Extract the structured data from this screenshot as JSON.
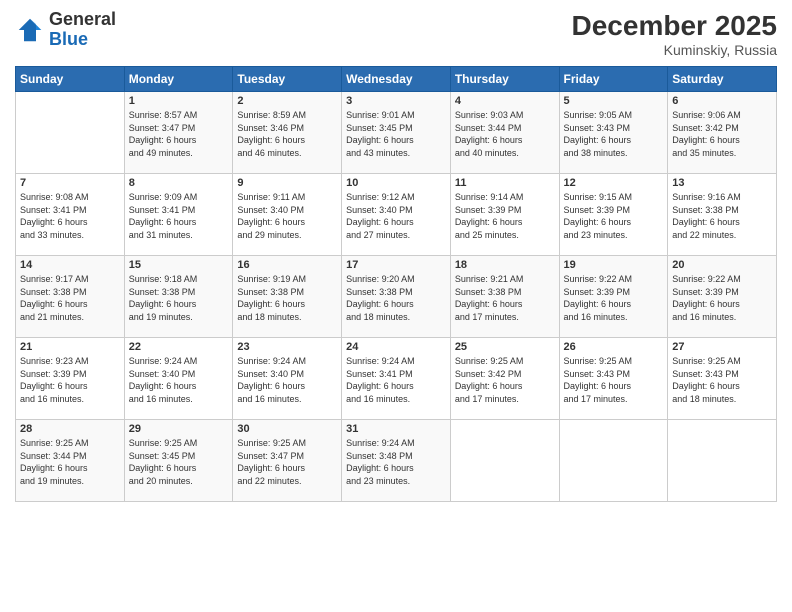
{
  "header": {
    "logo_general": "General",
    "logo_blue": "Blue",
    "title": "December 2025",
    "location": "Kuminskiy, Russia"
  },
  "days_of_week": [
    "Sunday",
    "Monday",
    "Tuesday",
    "Wednesday",
    "Thursday",
    "Friday",
    "Saturday"
  ],
  "weeks": [
    [
      {
        "day": "",
        "info": ""
      },
      {
        "day": "1",
        "info": "Sunrise: 8:57 AM\nSunset: 3:47 PM\nDaylight: 6 hours\nand 49 minutes."
      },
      {
        "day": "2",
        "info": "Sunrise: 8:59 AM\nSunset: 3:46 PM\nDaylight: 6 hours\nand 46 minutes."
      },
      {
        "day": "3",
        "info": "Sunrise: 9:01 AM\nSunset: 3:45 PM\nDaylight: 6 hours\nand 43 minutes."
      },
      {
        "day": "4",
        "info": "Sunrise: 9:03 AM\nSunset: 3:44 PM\nDaylight: 6 hours\nand 40 minutes."
      },
      {
        "day": "5",
        "info": "Sunrise: 9:05 AM\nSunset: 3:43 PM\nDaylight: 6 hours\nand 38 minutes."
      },
      {
        "day": "6",
        "info": "Sunrise: 9:06 AM\nSunset: 3:42 PM\nDaylight: 6 hours\nand 35 minutes."
      }
    ],
    [
      {
        "day": "7",
        "info": "Sunrise: 9:08 AM\nSunset: 3:41 PM\nDaylight: 6 hours\nand 33 minutes."
      },
      {
        "day": "8",
        "info": "Sunrise: 9:09 AM\nSunset: 3:41 PM\nDaylight: 6 hours\nand 31 minutes."
      },
      {
        "day": "9",
        "info": "Sunrise: 9:11 AM\nSunset: 3:40 PM\nDaylight: 6 hours\nand 29 minutes."
      },
      {
        "day": "10",
        "info": "Sunrise: 9:12 AM\nSunset: 3:40 PM\nDaylight: 6 hours\nand 27 minutes."
      },
      {
        "day": "11",
        "info": "Sunrise: 9:14 AM\nSunset: 3:39 PM\nDaylight: 6 hours\nand 25 minutes."
      },
      {
        "day": "12",
        "info": "Sunrise: 9:15 AM\nSunset: 3:39 PM\nDaylight: 6 hours\nand 23 minutes."
      },
      {
        "day": "13",
        "info": "Sunrise: 9:16 AM\nSunset: 3:38 PM\nDaylight: 6 hours\nand 22 minutes."
      }
    ],
    [
      {
        "day": "14",
        "info": "Sunrise: 9:17 AM\nSunset: 3:38 PM\nDaylight: 6 hours\nand 21 minutes."
      },
      {
        "day": "15",
        "info": "Sunrise: 9:18 AM\nSunset: 3:38 PM\nDaylight: 6 hours\nand 19 minutes."
      },
      {
        "day": "16",
        "info": "Sunrise: 9:19 AM\nSunset: 3:38 PM\nDaylight: 6 hours\nand 18 minutes."
      },
      {
        "day": "17",
        "info": "Sunrise: 9:20 AM\nSunset: 3:38 PM\nDaylight: 6 hours\nand 18 minutes."
      },
      {
        "day": "18",
        "info": "Sunrise: 9:21 AM\nSunset: 3:38 PM\nDaylight: 6 hours\nand 17 minutes."
      },
      {
        "day": "19",
        "info": "Sunrise: 9:22 AM\nSunset: 3:39 PM\nDaylight: 6 hours\nand 16 minutes."
      },
      {
        "day": "20",
        "info": "Sunrise: 9:22 AM\nSunset: 3:39 PM\nDaylight: 6 hours\nand 16 minutes."
      }
    ],
    [
      {
        "day": "21",
        "info": "Sunrise: 9:23 AM\nSunset: 3:39 PM\nDaylight: 6 hours\nand 16 minutes."
      },
      {
        "day": "22",
        "info": "Sunrise: 9:24 AM\nSunset: 3:40 PM\nDaylight: 6 hours\nand 16 minutes."
      },
      {
        "day": "23",
        "info": "Sunrise: 9:24 AM\nSunset: 3:40 PM\nDaylight: 6 hours\nand 16 minutes."
      },
      {
        "day": "24",
        "info": "Sunrise: 9:24 AM\nSunset: 3:41 PM\nDaylight: 6 hours\nand 16 minutes."
      },
      {
        "day": "25",
        "info": "Sunrise: 9:25 AM\nSunset: 3:42 PM\nDaylight: 6 hours\nand 17 minutes."
      },
      {
        "day": "26",
        "info": "Sunrise: 9:25 AM\nSunset: 3:43 PM\nDaylight: 6 hours\nand 17 minutes."
      },
      {
        "day": "27",
        "info": "Sunrise: 9:25 AM\nSunset: 3:43 PM\nDaylight: 6 hours\nand 18 minutes."
      }
    ],
    [
      {
        "day": "28",
        "info": "Sunrise: 9:25 AM\nSunset: 3:44 PM\nDaylight: 6 hours\nand 19 minutes."
      },
      {
        "day": "29",
        "info": "Sunrise: 9:25 AM\nSunset: 3:45 PM\nDaylight: 6 hours\nand 20 minutes."
      },
      {
        "day": "30",
        "info": "Sunrise: 9:25 AM\nSunset: 3:47 PM\nDaylight: 6 hours\nand 22 minutes."
      },
      {
        "day": "31",
        "info": "Sunrise: 9:24 AM\nSunset: 3:48 PM\nDaylight: 6 hours\nand 23 minutes."
      },
      {
        "day": "",
        "info": ""
      },
      {
        "day": "",
        "info": ""
      },
      {
        "day": "",
        "info": ""
      }
    ]
  ]
}
